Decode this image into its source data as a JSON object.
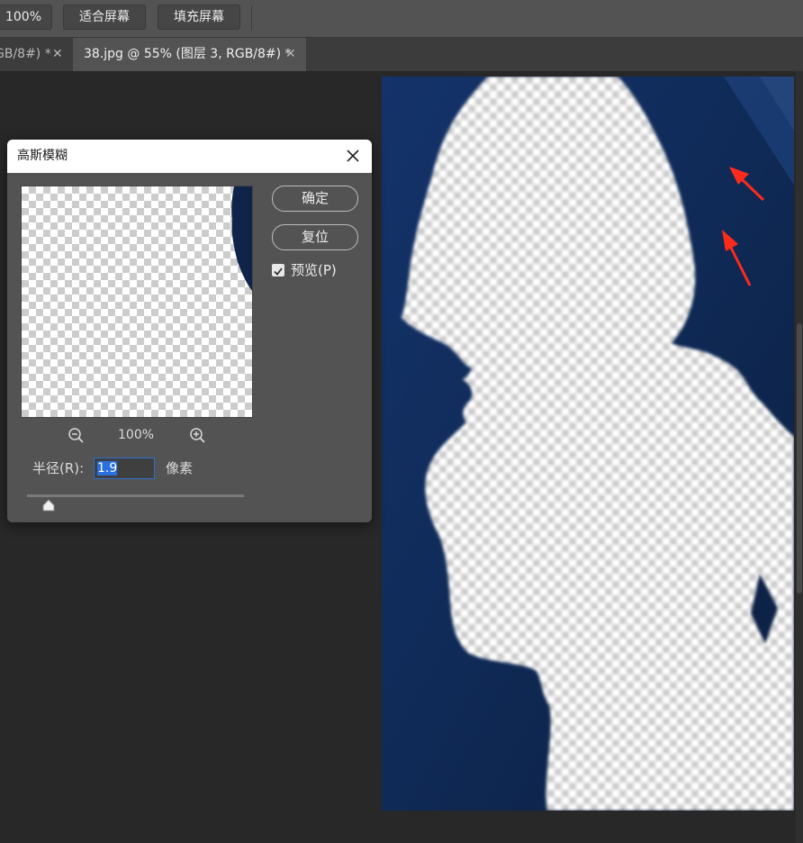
{
  "toolbar": {
    "zoom_label": "100%",
    "fit_screen_label": "适合屏幕",
    "fill_screen_label": "填充屏幕"
  },
  "tabs": [
    {
      "label": "GB/8#) *",
      "active": false
    },
    {
      "label": "38.jpg @ 55% (图层 3, RGB/8#) *",
      "active": true
    }
  ],
  "tab_close_glyph": "✕",
  "dialog": {
    "title": "高斯模糊",
    "ok_label": "确定",
    "reset_label": "复位",
    "preview_checkbox": {
      "label": "预览(P)",
      "checked": true
    },
    "zoom_level": "100%",
    "radius_label": "半径(R):",
    "radius_value": "1.9",
    "radius_unit": "像素",
    "slider_value": 1.9
  },
  "colors": {
    "background_navy": "#0f2448",
    "annotation_arrow": "#ff2a1a",
    "input_selection": "#2a6fde"
  },
  "icons": [
    "zoom-out-icon",
    "zoom-in-icon",
    "close-icon",
    "checkmark-icon",
    "slider-thumb-icon",
    "annotation-arrow-icon"
  ]
}
